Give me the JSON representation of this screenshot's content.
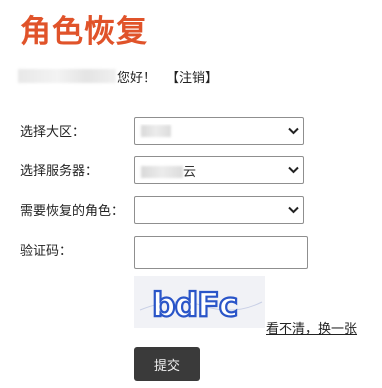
{
  "page": {
    "title": "角色恢复"
  },
  "greeting": {
    "text": "您好！",
    "logout_label": "【注销】"
  },
  "form": {
    "region": {
      "label": "选择大区：",
      "value": ""
    },
    "server": {
      "label": "选择服务器：",
      "value_suffix": "云"
    },
    "role": {
      "label": "需要恢复的角色：",
      "value": ""
    },
    "captcha": {
      "label": "验证码：",
      "input_value": "",
      "image_text": "bdFc",
      "refresh_link": "看不清，换一张"
    },
    "submit_label": "提交"
  },
  "colors": {
    "title": "#e0532a",
    "submit_bg": "#3a3a3a",
    "captcha_text": "#2a55c8"
  }
}
